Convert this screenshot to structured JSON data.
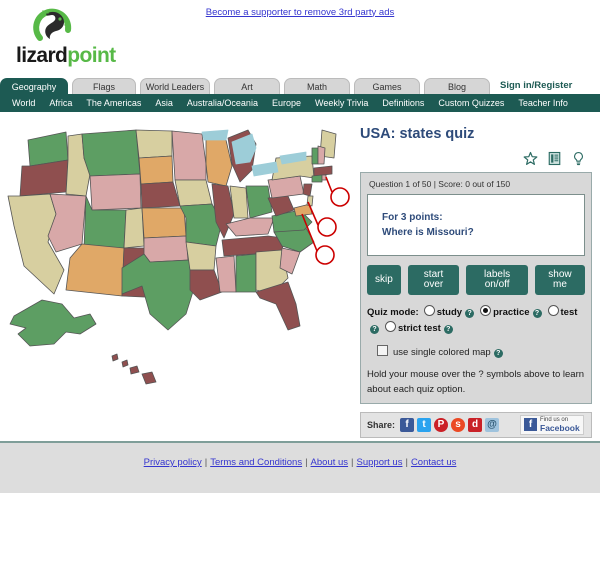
{
  "topbar": {
    "supporter_link": "Become a supporter to remove 3rd party ads"
  },
  "logo": {
    "text_part1": "lizard",
    "text_part2": "point",
    "mark_icon": "lizard-in-circle-logo",
    "color_green": "#57b947",
    "color_black": "#1a1a1a"
  },
  "nav": {
    "tabs": [
      {
        "label": "Geography",
        "active": true
      },
      {
        "label": "Flags",
        "active": false
      },
      {
        "label": "World Leaders",
        "active": false
      },
      {
        "label": "Art",
        "active": false
      },
      {
        "label": "Math",
        "active": false
      },
      {
        "label": "Games",
        "active": false
      },
      {
        "label": "Blog",
        "active": false
      }
    ],
    "signin_label": "Sign in/Register",
    "subnav": [
      "World",
      "Africa",
      "The Americas",
      "Asia",
      "Australia/Oceania",
      "Europe",
      "Weekly Trivia",
      "Definitions",
      "Custom Quizzes",
      "Teacher Info"
    ],
    "accent_color": "#1d5a53"
  },
  "quiz": {
    "title": "USA: states quiz",
    "icons": [
      "star-icon",
      "notes-icon",
      "lightbulb-icon"
    ],
    "status": "Question 1 of 50 | Score: 0 out of 150",
    "question_line1": "For 3 points:",
    "question_line2": "Where is Missouri?",
    "buttons": [
      {
        "label": "skip",
        "name": "skip-button"
      },
      {
        "label": "start over",
        "name": "start-over-button"
      },
      {
        "label": "labels on/off",
        "name": "labels-toggle-button"
      },
      {
        "label": "show me",
        "name": "show-me-button"
      }
    ],
    "mode_label": "Quiz mode:",
    "modes": [
      {
        "label": "study",
        "selected": false
      },
      {
        "label": "practice",
        "selected": true
      },
      {
        "label": "test",
        "selected": false
      },
      {
        "label": "strict test",
        "selected": false
      }
    ],
    "single_color_label": "use single colored map",
    "single_color_checked": false,
    "hint_text": "Hold your mouse over the ? symbols above to learn about each quiz option.",
    "help_glyph": "?",
    "button_color": "#2c6b63"
  },
  "share": {
    "label": "Share:",
    "icons": [
      {
        "name": "facebook-share-icon",
        "glyph": "f",
        "color": "#3b5998"
      },
      {
        "name": "twitter-share-icon",
        "glyph": "t",
        "color": "#2aa3ef"
      },
      {
        "name": "pinterest-share-icon",
        "glyph": "P",
        "color": "#cb2027"
      },
      {
        "name": "stumbleupon-share-icon",
        "glyph": "s",
        "color": "#eb4924"
      },
      {
        "name": "digg-share-icon",
        "glyph": "d",
        "color": "#c92228"
      },
      {
        "name": "email-share-icon",
        "glyph": "@",
        "color": "#9fc3dd"
      }
    ],
    "badge_line1": "Find us on",
    "badge_line2": "Facebook",
    "badge_glyph": "f"
  },
  "map": {
    "name": "usa-states-map",
    "markers": [
      {
        "label": "rhode-island-marker"
      },
      {
        "label": "delaware-marker"
      },
      {
        "label": "district-of-columbia-marker"
      }
    ],
    "marker_color": "#cc0000",
    "palette": [
      "#5d9e63",
      "#d7cfa0",
      "#d8a8a8",
      "#8f4f4f",
      "#e0a867",
      "#9dcdd8"
    ]
  },
  "footer": {
    "links": [
      "Privacy policy",
      "Terms and Conditions",
      "About us",
      "Support us",
      "Contact us"
    ],
    "separator": "|"
  }
}
